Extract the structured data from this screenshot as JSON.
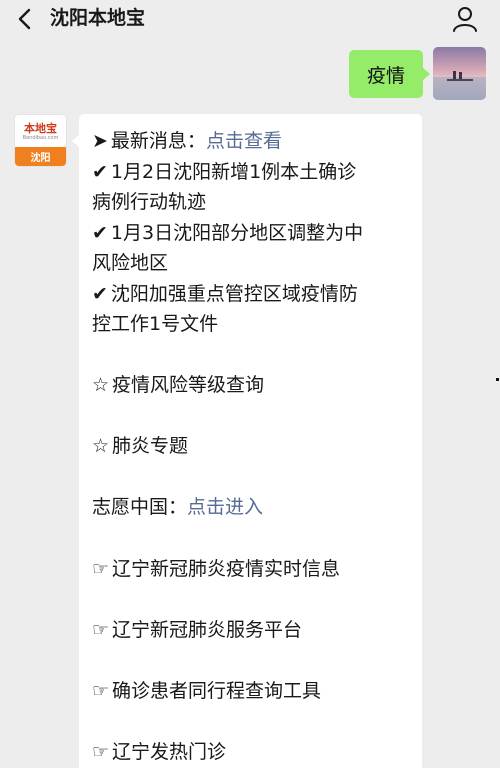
{
  "header": {
    "title": "沈阳本地宝"
  },
  "outgoing": {
    "text": "疫情"
  },
  "official_account": {
    "logo_text": "本地宝",
    "logo_url": "Bendibao.com",
    "city_label": "沈阳"
  },
  "message": {
    "latest": {
      "icon": "➤",
      "label": "最新消息：",
      "link": "点击查看"
    },
    "news": [
      {
        "icon": "✔",
        "line1": "1月2日沈阳新增1例本土确诊",
        "line2": "病例行动轨迹"
      },
      {
        "icon": "✔",
        "line1": "1月3日沈阳部分地区调整为中",
        "line2": "风险地区"
      },
      {
        "icon": "✔",
        "line1": "沈阳加强重点管控区域疫情防",
        "line2": "控工作1号文件"
      }
    ],
    "stars": [
      {
        "icon": "☆",
        "text": "疫情风险等级查询"
      },
      {
        "icon": "☆",
        "text": "肺炎专题"
      }
    ],
    "volunteer": {
      "label": "志愿中国：",
      "link": "点击进入"
    },
    "links": [
      {
        "icon": "☞",
        "text": "辽宁新冠肺炎疫情实时信息"
      },
      {
        "icon": "☞",
        "text": "辽宁新冠肺炎服务平台"
      },
      {
        "icon": "☞",
        "text": "确诊患者同行程查询工具"
      },
      {
        "icon": "☞",
        "text": "辽宁发热门诊"
      }
    ]
  },
  "icons": {
    "back": "chevron-left-icon",
    "profile": "person-icon"
  },
  "colors": {
    "background": "#ededed",
    "outgoing_bubble": "#95ec69",
    "link": "#576b95",
    "brand_orange": "#f0801f"
  }
}
